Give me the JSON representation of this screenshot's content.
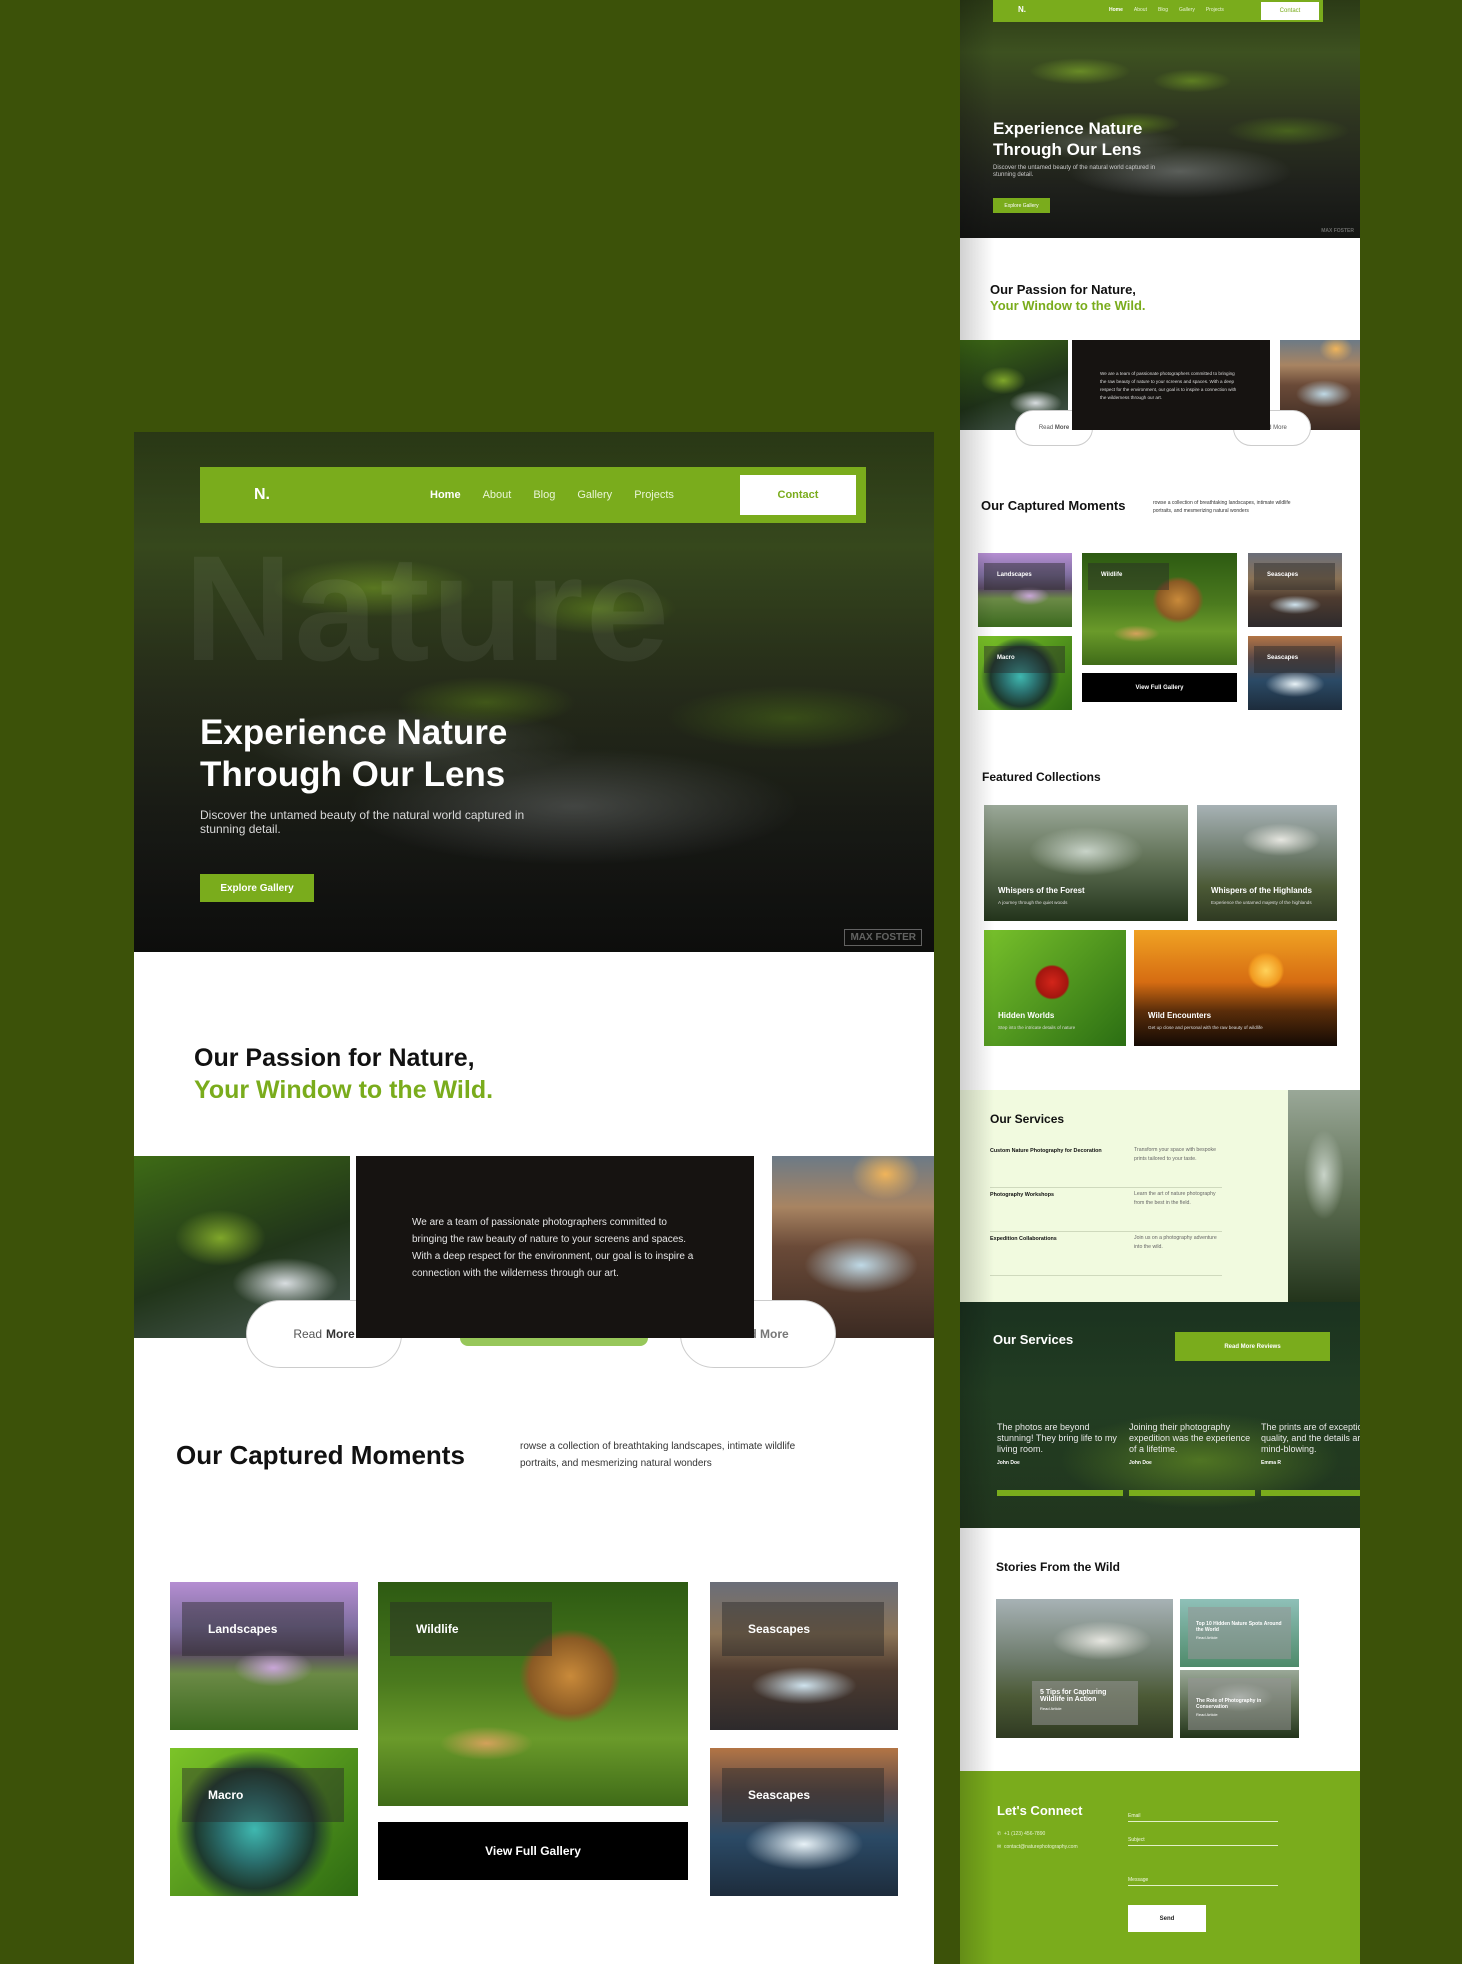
{
  "nav": {
    "logo": "N.",
    "items": [
      "Home",
      "About",
      "Blog",
      "Gallery",
      "Projects"
    ],
    "contact": "Contact"
  },
  "hero": {
    "title_line1": "Experience Nature",
    "title_line2": "Through Our Lens",
    "subtitle": "Discover the untamed beauty of the natural world captured in stunning detail.",
    "cta": "Explore Gallery",
    "watermark": "Nature",
    "credit": "MAX FOSTER"
  },
  "passion": {
    "line1": "Our Passion for Nature,",
    "line2": "Your Window to the Wild.",
    "body": "We are a team of passionate photographers committed to bringing the raw beauty of nature to your screens and spaces. With a deep respect for the environment, our goal is to inspire a connection with the wilderness through our art.",
    "read": "Read",
    "more": "More"
  },
  "moments": {
    "title": "Our Captured Moments",
    "desc": "rowse a collection of breathtaking landscapes, intimate wildlife portraits, and mesmerizing natural wonders",
    "tiles": [
      "Landscapes",
      "Wildlife",
      "Seascapes",
      "Macro",
      "Seascapes"
    ],
    "view_all": "View Full Gallery"
  },
  "collections": {
    "title": "Featured Collections",
    "items": [
      {
        "title": "Whispers of the Forest",
        "sub": "A journey through the quiet woods"
      },
      {
        "title": "Whispers of the Highlands",
        "sub": "Experience the untamed majesty of the highlands"
      },
      {
        "title": "Hidden Worlds",
        "sub": "Step into the intricate details of nature"
      },
      {
        "title": "Wild Encounters",
        "sub": "Get up close and personal with the raw beauty of wildlife"
      }
    ]
  },
  "services": {
    "title": "Our Services",
    "rows": [
      {
        "title": "Custom Nature Photography for Decoration",
        "desc": "Transform your space with bespoke prints tailored to your taste."
      },
      {
        "title": "Photography Workshops",
        "desc": "Learn the art of nature photography from the best in the field."
      },
      {
        "title": "Expedition Collaborations",
        "desc": "Join us on a photography adventure into the wild."
      }
    ]
  },
  "reviews": {
    "title": "Our Services",
    "button": "Read More Reviews",
    "items": [
      {
        "quote": "The photos are beyond stunning! They bring life to my living room.",
        "name": "John Doe"
      },
      {
        "quote": "Joining their photography expedition was the experience of a lifetime.",
        "name": "John Doe"
      },
      {
        "quote": "The prints are of exceptional quality, and the details are mind-blowing.",
        "name": "Emma R"
      }
    ]
  },
  "stories": {
    "title": "Stories From the Wild",
    "main": {
      "title": "5 Tips for Capturing Wildlife in Action",
      "link": "Read Article"
    },
    "side": [
      {
        "title": "Top 10 Hidden Nature Spots Around the World",
        "link": "Read Article"
      },
      {
        "title": "The Role of Photography in Conservation",
        "link": "Read Article"
      }
    ]
  },
  "connect": {
    "title": "Let's Connect",
    "phone": "+1 (123) 456-7890",
    "email": "contact@naturephotography.com",
    "fields": [
      "Email",
      "Subject",
      "Message"
    ],
    "send": "Send"
  },
  "colors": {
    "brand_green": "#7aac1c",
    "page_bg": "#3c5209",
    "dark_panel": "#161311"
  }
}
